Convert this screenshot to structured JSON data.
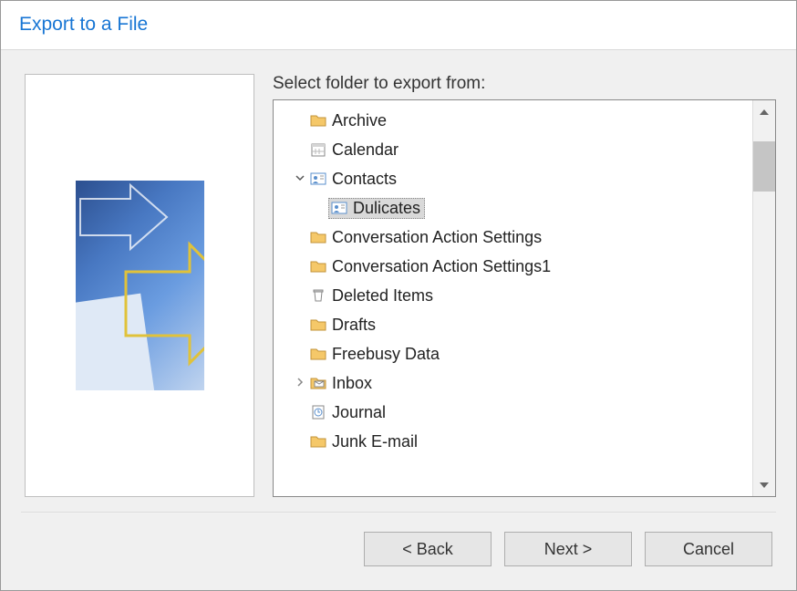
{
  "title": "Export to a File",
  "label": "Select folder to export from:",
  "folders": [
    {
      "name": "Archive",
      "icon": "folder",
      "indent": 0
    },
    {
      "name": "Calendar",
      "icon": "calendar",
      "indent": 0
    },
    {
      "name": "Contacts",
      "icon": "contacts",
      "indent": 0,
      "expander": "down"
    },
    {
      "name": "Dulicates",
      "icon": "contacts",
      "indent": 1,
      "selected": true
    },
    {
      "name": "Conversation Action Settings",
      "icon": "folder",
      "indent": 0
    },
    {
      "name": "Conversation Action Settings1",
      "icon": "folder",
      "indent": 0
    },
    {
      "name": "Deleted Items",
      "icon": "trash",
      "indent": 0
    },
    {
      "name": "Drafts",
      "icon": "folder",
      "indent": 0
    },
    {
      "name": "Freebusy Data",
      "icon": "folder",
      "indent": 0
    },
    {
      "name": "Inbox",
      "icon": "inbox",
      "indent": 0,
      "expander": "right"
    },
    {
      "name": "Journal",
      "icon": "journal",
      "indent": 0
    },
    {
      "name": "Junk E-mail",
      "icon": "folder",
      "indent": 0
    }
  ],
  "buttons": {
    "back": "< Back",
    "next": "Next >",
    "cancel": "Cancel"
  }
}
